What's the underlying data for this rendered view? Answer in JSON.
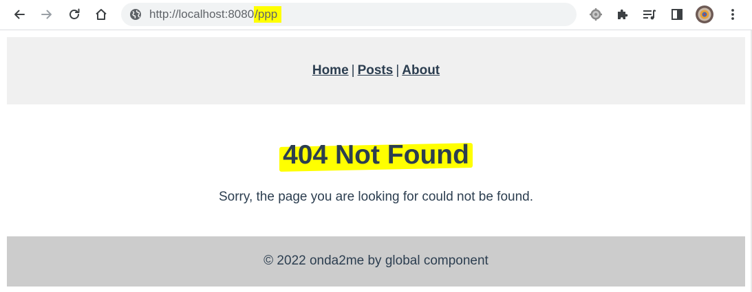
{
  "browser": {
    "url_host": "http://localhost:8080",
    "url_path": "/ppp",
    "icons": {
      "back": "arrow-left-icon",
      "forward": "arrow-right-icon",
      "reload": "reload-icon",
      "home": "home-icon",
      "site_info": "globe-icon",
      "settings": "gear-icon",
      "extensions": "puzzle-icon",
      "media": "media-queue-icon",
      "side_panel": "side-panel-icon",
      "profile": "avatar",
      "menu": "kebab-menu-icon"
    },
    "colors": {
      "toolbar": "#ffffff",
      "omnibox": "#f1f3f4",
      "highlight": "#ffff00"
    }
  },
  "header": {
    "nav": [
      {
        "label": "Home"
      },
      {
        "label": "Posts"
      },
      {
        "label": "About"
      }
    ],
    "separator": "|",
    "background": "#f0f0f0"
  },
  "main": {
    "title": "404 Not Found",
    "message": "Sorry, the page you are looking for could not be found.",
    "text_color": "#2c3e50"
  },
  "footer": {
    "text": "© 2022 onda2me by global component",
    "background": "#cccccc"
  }
}
